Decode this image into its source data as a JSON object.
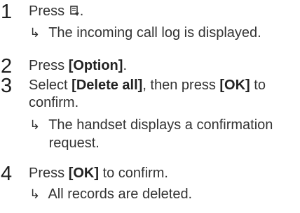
{
  "steps": [
    {
      "number": "1",
      "line1_prefix": "Press",
      "line1_icon": "call-log-icon",
      "line1_suffix": ".",
      "result": "The incoming call log is displayed."
    },
    {
      "number": "2",
      "line1_prefix": "Press ",
      "line1_bold": "[Option]",
      "line1_suffix": "."
    },
    {
      "number": "3",
      "line1_prefix": "Select ",
      "line1_bold": "[Delete all]",
      "line1_mid": ", then press ",
      "line1_bold2": "[OK]",
      "line1_suffix": " to",
      "line2": "confirm.",
      "result_line1": "The handset displays a confirmation",
      "result_line2": "request."
    },
    {
      "number": "4",
      "line1_prefix": "Press ",
      "line1_bold": "[OK]",
      "line1_suffix": " to confirm.",
      "result": "All records are deleted."
    }
  ],
  "arrow_glyph": "↳"
}
